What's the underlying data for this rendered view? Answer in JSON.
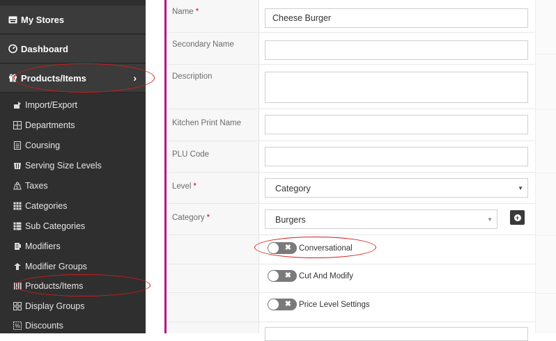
{
  "sidebar": {
    "main": [
      {
        "label": "My Stores",
        "icon": "store-icon"
      },
      {
        "label": "Dashboard",
        "icon": "dashboard-icon"
      },
      {
        "label": "Products/Items",
        "icon": "gift-icon",
        "chevron": "›"
      }
    ],
    "sub": [
      {
        "label": "Import/Export",
        "icon": "import-export-icon"
      },
      {
        "label": "Departments",
        "icon": "departments-icon"
      },
      {
        "label": "Coursing",
        "icon": "coursing-icon"
      },
      {
        "label": "Serving Size Levels",
        "icon": "serving-size-icon"
      },
      {
        "label": "Taxes",
        "icon": "taxes-icon"
      },
      {
        "label": "Categories",
        "icon": "categories-icon"
      },
      {
        "label": "Sub Categories",
        "icon": "sub-categories-icon"
      },
      {
        "label": "Modifiers",
        "icon": "modifiers-icon"
      },
      {
        "label": "Modifier Groups",
        "icon": "modifier-groups-icon"
      },
      {
        "label": "Products/Items",
        "icon": "products-items-icon"
      },
      {
        "label": "Display Groups",
        "icon": "display-groups-icon"
      },
      {
        "label": "Discounts",
        "icon": "discounts-icon"
      }
    ]
  },
  "form": {
    "name": {
      "label": "Name",
      "required": "*",
      "value": "Cheese Burger"
    },
    "secondary_name": {
      "label": "Secondary Name",
      "value": ""
    },
    "description": {
      "label": "Description",
      "value": ""
    },
    "kitchen_print_name": {
      "label": "Kitchen Print Name",
      "value": ""
    },
    "plu_code": {
      "label": "PLU Code",
      "value": ""
    },
    "level": {
      "label": "Level",
      "required": "*",
      "value": "Category"
    },
    "category": {
      "label": "Category",
      "required": "*",
      "value": "Burgers"
    },
    "toggles": [
      {
        "label": "Conversational",
        "state": "off"
      },
      {
        "label": "Cut And Modify",
        "state": "off"
      },
      {
        "label": "Price Level Settings",
        "state": "off"
      }
    ]
  },
  "colors": {
    "sidebar_bg": "#2f2f2f",
    "accent": "#b2187f",
    "highlight": "#d61a1a",
    "required": "#d0021b"
  }
}
